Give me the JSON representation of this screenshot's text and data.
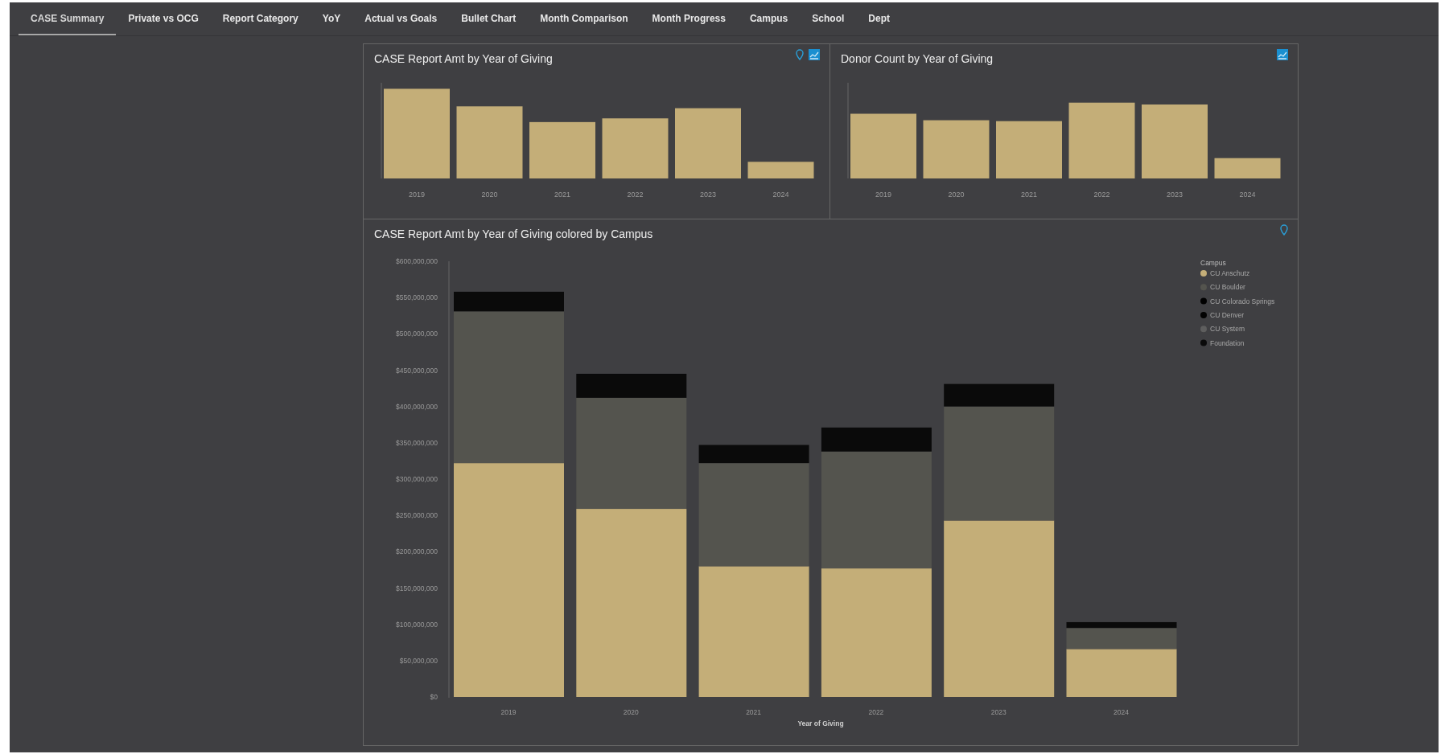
{
  "tabs": [
    {
      "label": "CASE Summary",
      "selected": true
    },
    {
      "label": "Private vs OCG",
      "selected": false
    },
    {
      "label": "Report Category",
      "selected": false
    },
    {
      "label": "YoY",
      "selected": false
    },
    {
      "label": "Actual vs Goals",
      "selected": false
    },
    {
      "label": "Bullet Chart",
      "selected": false
    },
    {
      "label": "Month Comparison",
      "selected": false
    },
    {
      "label": "Month Progress",
      "selected": false
    },
    {
      "label": "Campus",
      "selected": false
    },
    {
      "label": "School",
      "selected": false
    },
    {
      "label": "Dept",
      "selected": false
    }
  ],
  "top_charts": [
    {
      "title": "CASE Report Amt by Year of Giving",
      "icons": [
        {
          "kind": "pin"
        },
        {
          "kind": "chart"
        }
      ],
      "x_labels": [
        "2019",
        "2020",
        "2021",
        "2022",
        "2023",
        "2024"
      ]
    },
    {
      "title": "Donor Count by Year of Giving",
      "icons": [
        {
          "kind": "chart"
        }
      ],
      "x_labels": [
        "2019",
        "2020",
        "2021",
        "2022",
        "2023",
        "2024"
      ]
    }
  ],
  "main_chart": {
    "title": "CASE Report Amt by Year of Giving colored by Campus",
    "icons": [
      {
        "kind": "pin"
      }
    ],
    "chart_data": {
      "type": "bar",
      "stacked": true,
      "xlabel": "Year of Giving",
      "legend": {
        "title": "Campus"
      },
      "categories": [
        "2019",
        "2020",
        "2021",
        "2022",
        "2023",
        "2024"
      ],
      "series": [
        {
          "name": "CU Anschutz",
          "color": "#c4ae78",
          "values": [
            322000000,
            259000000,
            180000000,
            177000000,
            243000000,
            66000000
          ]
        },
        {
          "name": "CU Boulder",
          "color": "#54544e",
          "values": [
            209000000,
            153000000,
            142000000,
            161000000,
            157000000,
            29000000
          ]
        },
        {
          "name": "CU Colorado Springs",
          "color": "#000000",
          "values": [
            null,
            null,
            null,
            null,
            null,
            null
          ]
        },
        {
          "name": "CU Denver",
          "color": "#020202",
          "values": [
            null,
            null,
            null,
            null,
            null,
            null
          ]
        },
        {
          "name": "CU System",
          "color": "#5e5e5e",
          "values": [
            null,
            null,
            null,
            null,
            null,
            null
          ]
        },
        {
          "name": "Foundation",
          "color": "#0a0a0a",
          "values": [
            27000000,
            33000000,
            25000000,
            33000000,
            31000000,
            8000000
          ]
        }
      ],
      "ylim": [
        0,
        600000000
      ],
      "yticks": [
        {
          "value": 0,
          "label": "$0"
        },
        {
          "value": 50000000,
          "label": "$50,000,000"
        },
        {
          "value": 100000000,
          "label": "$100,000,000"
        },
        {
          "value": 150000000,
          "label": "$150,000,000"
        },
        {
          "value": 200000000,
          "label": "$200,000,000"
        },
        {
          "value": 250000000,
          "label": "$250,000,000"
        },
        {
          "value": 300000000,
          "label": "$300,000,000"
        },
        {
          "value": 350000000,
          "label": "$350,000,000"
        },
        {
          "value": 400000000,
          "label": "$400,000,000"
        },
        {
          "value": 450000000,
          "label": "$450,000,000"
        },
        {
          "value": 500000000,
          "label": "$500,000,000"
        },
        {
          "value": 550000000,
          "label": "$550,000,000"
        },
        {
          "value": 600000000,
          "label": "$600,000,000"
        }
      ]
    }
  }
}
